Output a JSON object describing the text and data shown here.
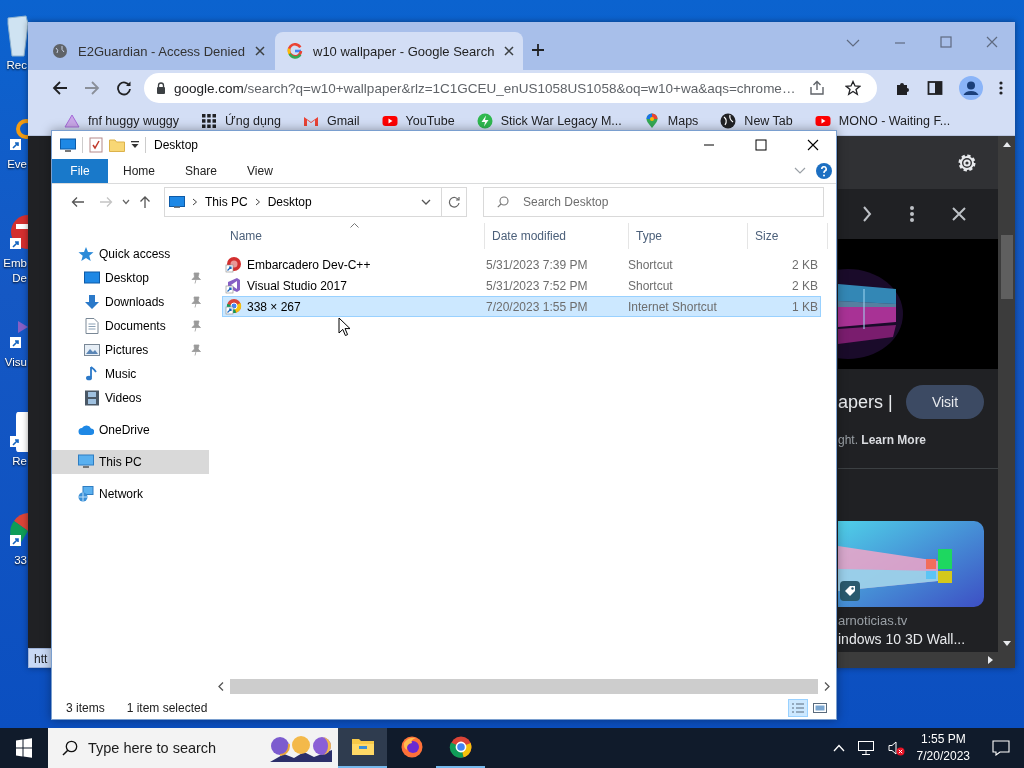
{
  "desktop": {
    "icons": [
      {
        "kind": "recycle-bin",
        "shortcut": false,
        "lines": [
          "Rec"
        ]
      },
      {
        "kind": "app",
        "shortcut": true,
        "lines": [
          "Eve"
        ]
      },
      {
        "kind": "devcpp",
        "shortcut": true,
        "lines": [
          "Emb",
          "De"
        ]
      },
      {
        "kind": "vs",
        "shortcut": true,
        "lines": [
          "Visu"
        ]
      },
      {
        "kind": "document",
        "shortcut": true,
        "lines": [
          "Re"
        ]
      },
      {
        "kind": "chrome",
        "shortcut": true,
        "lines": [
          "33"
        ]
      }
    ]
  },
  "browser": {
    "tabs": [
      {
        "title": "E2Guardian - Access Denied",
        "kind": "globe",
        "selected": false
      },
      {
        "title": "w10 wallpaper - Google Search",
        "kind": "google",
        "selected": true
      }
    ],
    "address": {
      "host": "google.com",
      "path": "/search?q=w10+wallpaper&rlz=1C1GCEU_enUS1058US1058&oq=w10+wa&aqs=chrome…"
    },
    "bookmarks": [
      {
        "label": "fnf huggy wuggy",
        "kind": "triangle"
      },
      {
        "label": "Ứng dụng",
        "kind": "apps"
      },
      {
        "label": "Gmail",
        "kind": "gmail"
      },
      {
        "label": "YouTube",
        "kind": "youtube"
      },
      {
        "label": "Stick War Legacy M...",
        "kind": "bolt"
      },
      {
        "label": "Maps",
        "kind": "maps"
      },
      {
        "label": "New Tab",
        "kind": "globe"
      },
      {
        "label": "MONO - Waiting F...",
        "kind": "youtube"
      }
    ],
    "page": {
      "result_title": "apers |",
      "visit_button": "Visit",
      "notice": "ght. **Learn More**",
      "source": "arnoticias.tv",
      "caption": "indows 10 3D Wall..."
    },
    "status_url": "htt"
  },
  "explorer": {
    "title": "Desktop",
    "ribbon_tabs": [
      {
        "label": "File",
        "selected": true
      },
      {
        "label": "Home",
        "selected": false
      },
      {
        "label": "Share",
        "selected": false
      },
      {
        "label": "View",
        "selected": false
      }
    ],
    "breadcrumb": [
      "This PC",
      "Desktop"
    ],
    "search": {
      "placeholder": "Search Desktop"
    },
    "nav": [
      {
        "label": "Quick access",
        "kind": "star",
        "selected": false,
        "children": [
          {
            "label": "Desktop",
            "kind": "desktop",
            "pinned": true,
            "selected": false
          },
          {
            "label": "Downloads",
            "kind": "downloads",
            "pinned": true,
            "selected": false
          },
          {
            "label": "Documents",
            "kind": "documents",
            "pinned": true,
            "selected": false
          },
          {
            "label": "Pictures",
            "kind": "pictures",
            "pinned": true,
            "selected": false
          },
          {
            "label": "Music",
            "kind": "music",
            "pinned": false,
            "selected": false
          },
          {
            "label": "Videos",
            "kind": "videos",
            "pinned": false,
            "selected": false
          }
        ]
      },
      {
        "label": "OneDrive",
        "kind": "cloud",
        "selected": false
      },
      {
        "label": "This PC",
        "kind": "pc",
        "selected": true
      },
      {
        "label": "Network",
        "kind": "network",
        "selected": false
      }
    ],
    "columns": [
      "Name",
      "Date modified",
      "Type",
      "Size"
    ],
    "files": [
      {
        "name": "Embarcadero Dev-C++",
        "kind": "devcpp",
        "date": "5/31/2023 7:39 PM",
        "type": "Shortcut",
        "size": "2 KB",
        "selected": false
      },
      {
        "name": "Visual Studio 2017",
        "kind": "vs",
        "date": "5/31/2023 7:52 PM",
        "type": "Shortcut",
        "size": "2 KB",
        "selected": false
      },
      {
        "name": "338 × 267",
        "kind": "chrome",
        "date": "7/20/2023 1:55 PM",
        "type": "Internet Shortcut",
        "size": "1 KB",
        "selected": true
      }
    ],
    "status": {
      "count": "3 items",
      "selection": "1 item selected"
    }
  },
  "taskbar": {
    "search": {
      "placeholder": "Type here to search"
    },
    "apps": [
      {
        "kind": "explorer",
        "active": true,
        "running": true
      },
      {
        "kind": "firefox",
        "active": false,
        "running": false
      },
      {
        "kind": "chrome",
        "active": false,
        "running": true
      }
    ],
    "volume_muted": true,
    "time": "1:55 PM",
    "date": "7/20/2023"
  }
}
